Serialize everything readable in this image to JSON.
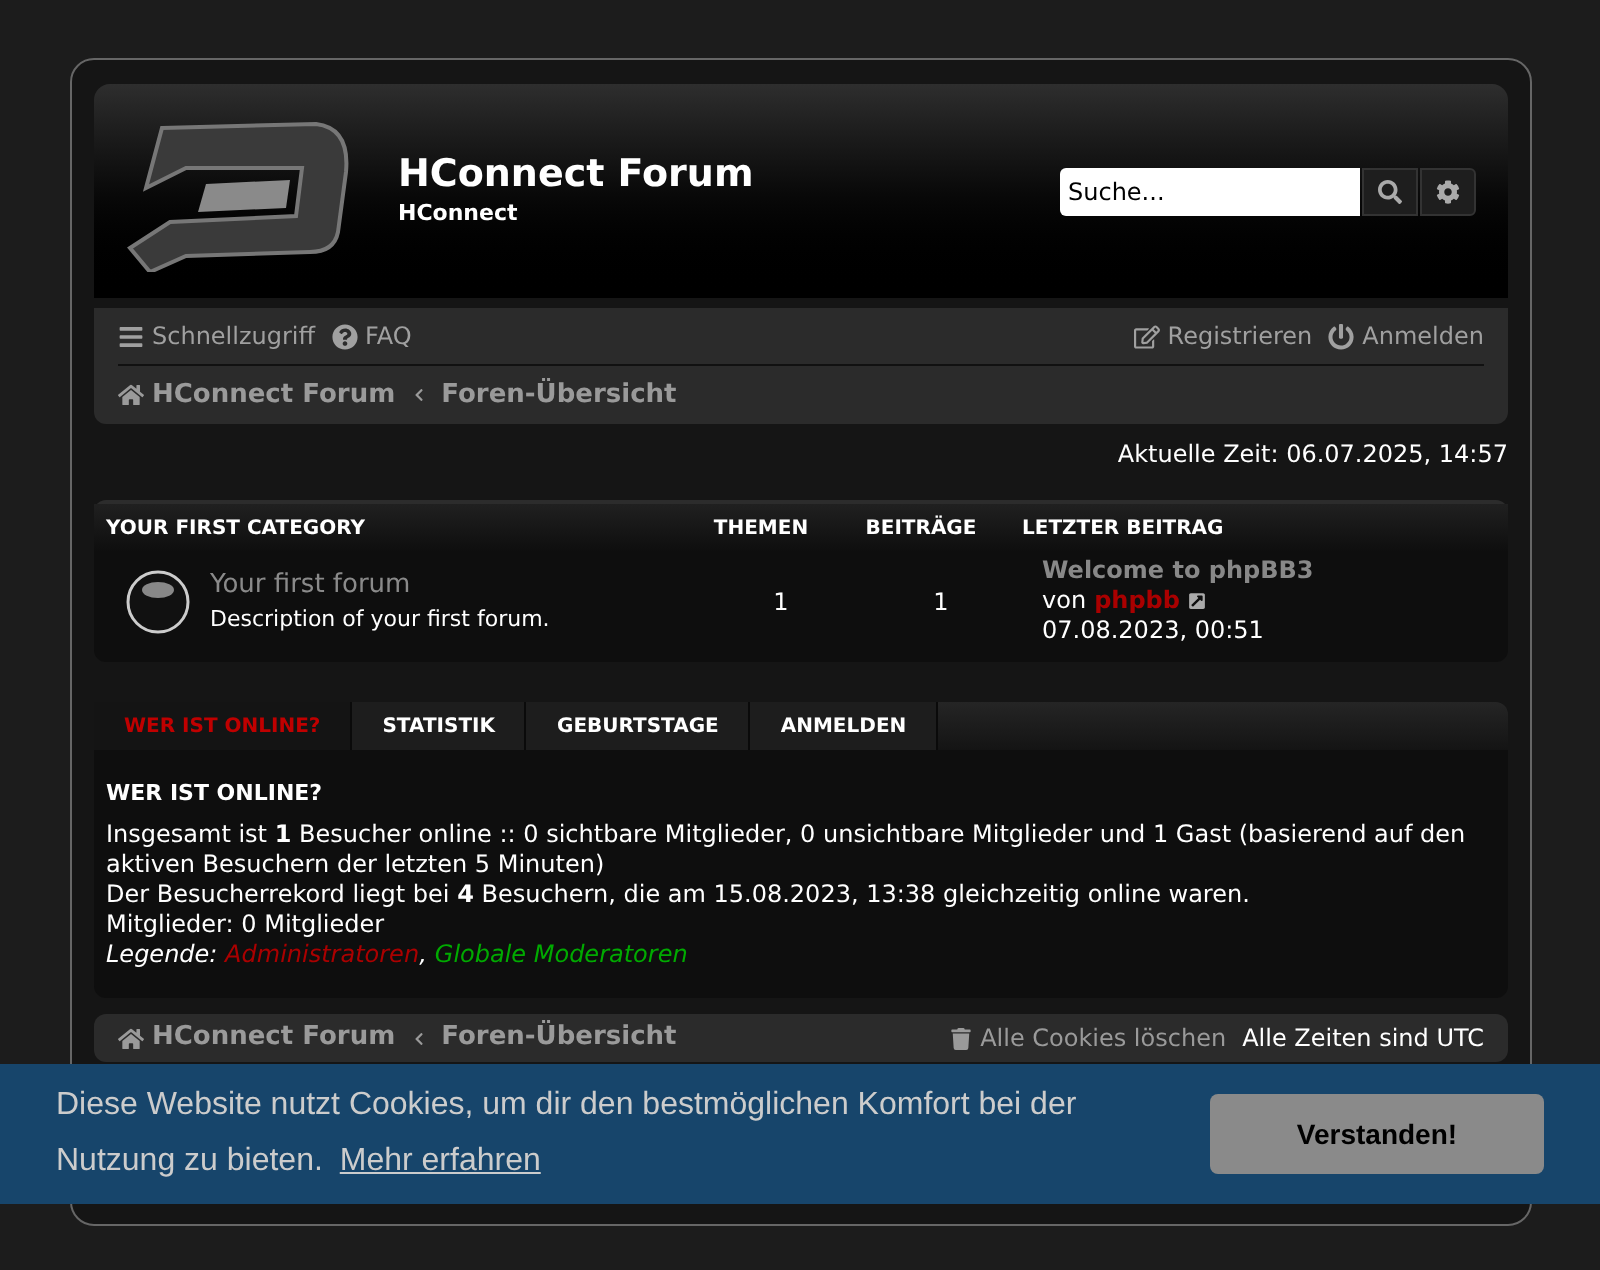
{
  "header": {
    "title": "HConnect Forum",
    "subtitle": "HConnect",
    "search": {
      "placeholder": "Suche..."
    }
  },
  "nav": {
    "left": [
      "Schnellzugriff",
      "FAQ"
    ],
    "right": [
      "Registrieren",
      "Anmelden"
    ]
  },
  "breadcrumb": [
    "HConnect Forum",
    "Foren-Übersicht"
  ],
  "current_time": "Aktuelle Zeit: 06.07.2025, 14:57",
  "category": {
    "columns": [
      "YOUR FIRST CATEGORY",
      "THEMEN",
      "BEITRÄGE",
      "LETZTER BEITRAG"
    ],
    "forums": [
      {
        "name": "Your first forum",
        "description": "Description of your first forum.",
        "topics": "1",
        "posts": "1",
        "last_post": {
          "title": "Welcome to phpBB3",
          "by": "von",
          "author": "phpbb",
          "date": "07.08.2023, 00:51"
        }
      }
    ]
  },
  "tabs": [
    {
      "label": "WER IST ONLINE?",
      "selected": true
    },
    {
      "label": "STATISTIK",
      "selected": false
    },
    {
      "label": "GEBURTSTAGE",
      "selected": false
    },
    {
      "label": "ANMELDEN",
      "selected": false
    }
  ],
  "online": {
    "heading": "WER IST ONLINE?",
    "lines": [
      "Insgesamt ist **1** Besucher online :: 0 sichtbare Mitglieder, 0 unsichtbare Mitglieder und 1 Gast (basierend auf den aktiven Besuchern der letzten 5 Minuten)",
      "Der Besucherrekord liegt bei **4** Besuchern, die am 15.08.2023, 13:38 gleichzeitig online waren.",
      "Mitglieder: 0 Mitglieder"
    ],
    "legend": {
      "label": "Legende:",
      "separator": ",",
      "groups": [
        {
          "name": "Administratoren",
          "color": "#aa0000"
        },
        {
          "name": "Globale Moderatoren",
          "color": "#00aa00"
        }
      ]
    }
  },
  "footer_bar": {
    "breadcrumb": [
      "HConnect Forum",
      "Foren-Übersicht"
    ],
    "delete_cookies": "Alle Cookies löschen",
    "timezone": "Alle Zeiten sind UTC"
  },
  "cookie_banner": {
    "message": "Diese Website nutzt Cookies, um dir den bestmöglichen Komfort bei der Nutzung zu bieten.",
    "link": "Mehr erfahren",
    "button": "Verstanden!"
  }
}
